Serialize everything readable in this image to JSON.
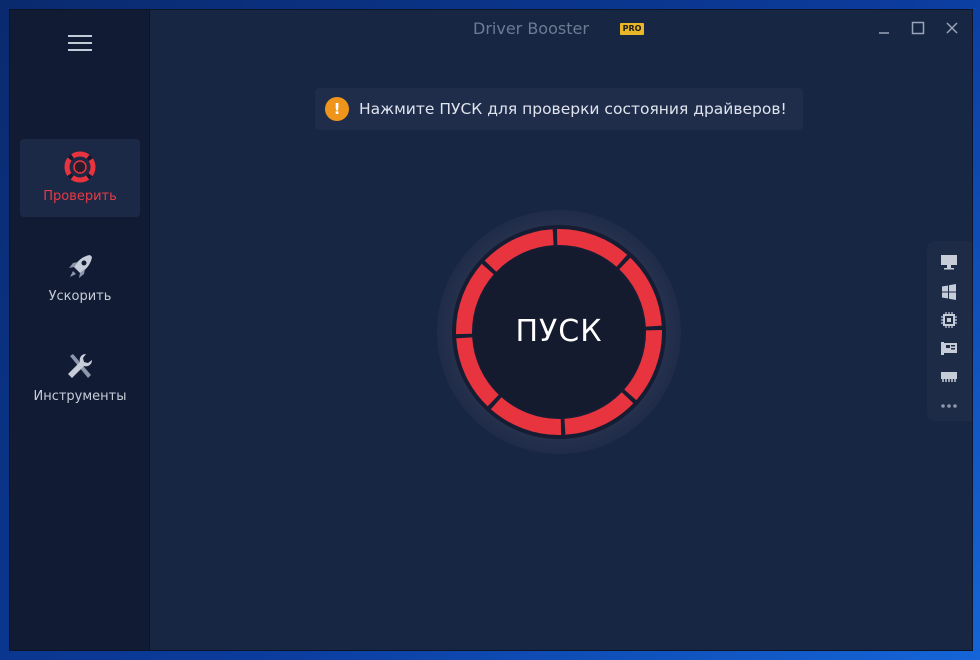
{
  "app": {
    "title": "Driver Booster",
    "badge": "PRO"
  },
  "sidebar": {
    "items": [
      {
        "label": "Проверить",
        "icon": "lifebuoy-icon",
        "active": true
      },
      {
        "label": "Ускорить",
        "icon": "rocket-icon",
        "active": false
      },
      {
        "label": "Инструменты",
        "icon": "tools-icon",
        "active": false
      }
    ]
  },
  "banner": {
    "icon": "info-icon",
    "icon_glyph": "!",
    "text": "Нажмите ПУСК для проверки состояния драйверов!"
  },
  "scan_button": {
    "label": "ПУСК"
  },
  "right_panel": {
    "icons": [
      "monitor-icon",
      "windows-icon",
      "chip-icon",
      "network-card-icon",
      "memory-icon",
      "more-icon"
    ]
  },
  "colors": {
    "accent_red": "#e8343e",
    "background": "#172643",
    "sidebar": "#111b33",
    "badge": "#e8b627",
    "info": "#f0951c"
  }
}
